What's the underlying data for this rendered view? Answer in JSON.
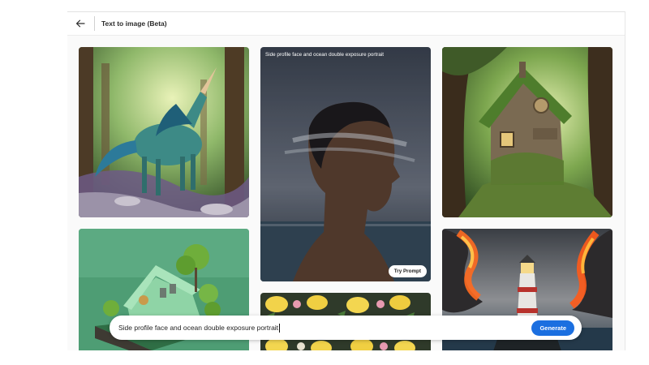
{
  "header": {
    "back_icon": "arrow-left-icon",
    "title": "Text to image (Beta)"
  },
  "gallery": {
    "featured": {
      "caption": "Side profile face and ocean double exposure portrait",
      "try_button": "Try Prompt"
    },
    "tiles": [
      "unicorn in enchanted forest",
      "side profile ocean double exposure portrait",
      "mossy fairy cottage in forest",
      "green toy house on island",
      "lemon and floral pattern",
      "lighthouse with fiery clouds"
    ]
  },
  "prompt": {
    "value": "Side profile face and ocean double exposure portrait",
    "generate_label": "Generate"
  },
  "colors": {
    "accent": "#1b6fe0"
  }
}
